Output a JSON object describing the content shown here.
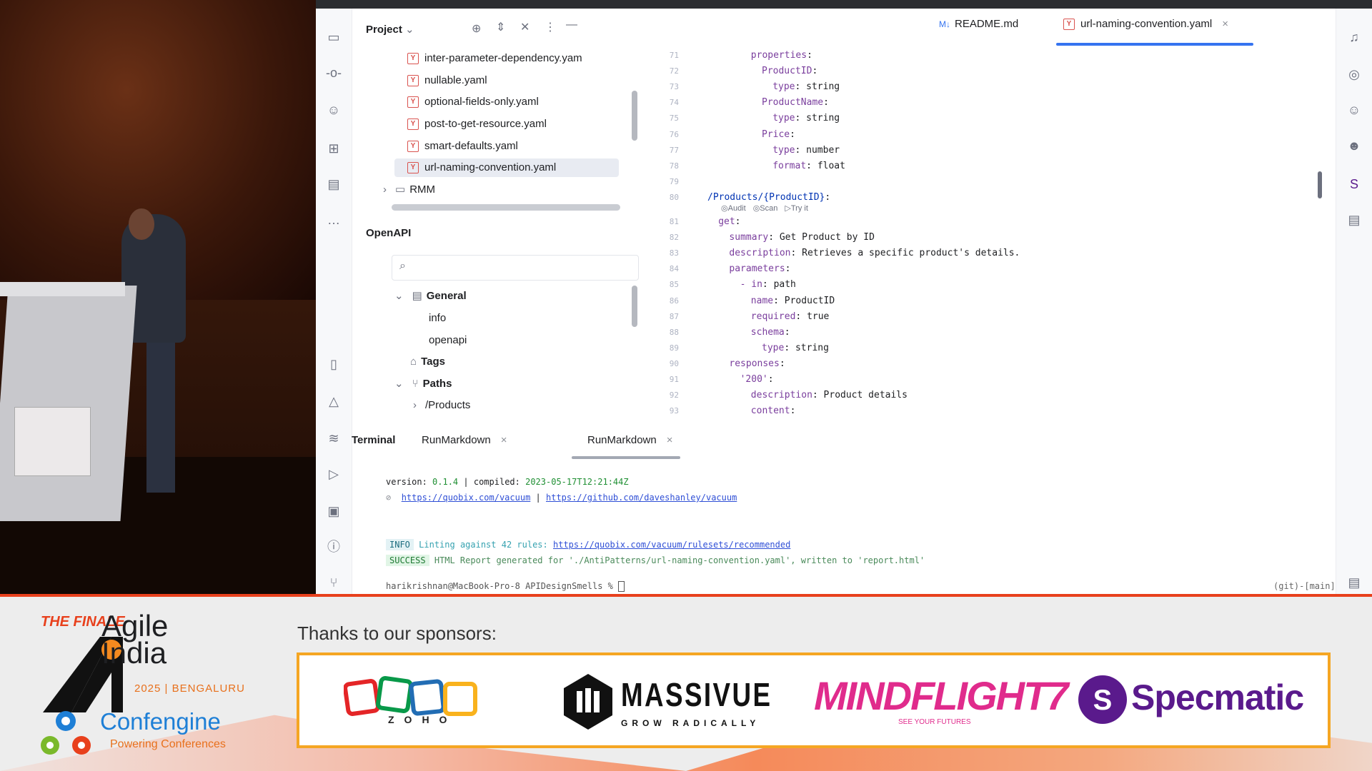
{
  "ide": {
    "project_title": "Project",
    "files": [
      "inter-parameter-dependency.yam",
      "nullable.yaml",
      "optional-fields-only.yaml",
      "post-to-get-resource.yaml",
      "smart-defaults.yaml",
      "url-naming-convention.yaml"
    ],
    "folder": "RMM",
    "openapi_title": "OpenAPI",
    "openapi_tree": {
      "general": "General",
      "info": "info",
      "openapi": "openapi",
      "tags": "Tags",
      "paths": "Paths",
      "products": "/Products"
    },
    "tabs": [
      {
        "icon": "M↓",
        "label": "README.md"
      },
      {
        "icon": "Y",
        "label": "url-naming-convention.yaml"
      }
    ],
    "code_lens": [
      "Audit",
      "Scan",
      "Try it"
    ],
    "lines": [
      {
        "n": "71",
        "indent": 8,
        "key": "properties",
        "val": ""
      },
      {
        "n": "72",
        "indent": 10,
        "key": "ProductID",
        "val": ""
      },
      {
        "n": "73",
        "indent": 12,
        "key": "type",
        "val": "string"
      },
      {
        "n": "74",
        "indent": 10,
        "key": "ProductName",
        "val": ""
      },
      {
        "n": "75",
        "indent": 12,
        "key": "type",
        "val": "string"
      },
      {
        "n": "76",
        "indent": 10,
        "key": "Price",
        "val": ""
      },
      {
        "n": "77",
        "indent": 12,
        "key": "type",
        "val": "number"
      },
      {
        "n": "78",
        "indent": 12,
        "key": "format",
        "val": "float"
      },
      {
        "n": "79",
        "indent": 0,
        "key": "",
        "val": ""
      },
      {
        "n": "80",
        "indent": 0,
        "key": "/Products/{ProductID}",
        "val": ""
      },
      {
        "n": "81",
        "indent": 2,
        "key": "get",
        "val": ""
      },
      {
        "n": "82",
        "indent": 4,
        "key": "summary",
        "val": "Get Product by ID"
      },
      {
        "n": "83",
        "indent": 4,
        "key": "description",
        "val": "Retrieves a specific product's details."
      },
      {
        "n": "84",
        "indent": 4,
        "key": "parameters",
        "val": ""
      },
      {
        "n": "85",
        "indent": 6,
        "key": "- in",
        "val": "path"
      },
      {
        "n": "86",
        "indent": 8,
        "key": "name",
        "val": "ProductID"
      },
      {
        "n": "87",
        "indent": 8,
        "key": "required",
        "val": "true"
      },
      {
        "n": "88",
        "indent": 8,
        "key": "schema",
        "val": ""
      },
      {
        "n": "89",
        "indent": 10,
        "key": "type",
        "val": "string"
      },
      {
        "n": "90",
        "indent": 4,
        "key": "responses",
        "val": ""
      },
      {
        "n": "91",
        "indent": 6,
        "key": "'200'",
        "val": ""
      },
      {
        "n": "92",
        "indent": 8,
        "key": "description",
        "val": "Product details"
      },
      {
        "n": "93",
        "indent": 8,
        "key": "content",
        "val": ""
      }
    ],
    "terminal_tabs": [
      "Terminal",
      "RunMarkdown",
      "RunMarkdown"
    ],
    "terminal": {
      "version_label": "version:",
      "version": "0.1.4",
      "compiled_label": "| compiled:",
      "compiled": "2023-05-17T12:21:44Z",
      "link1": "https://quobix.com/vacuum",
      "link2": "https://github.com/daveshanley/vacuum",
      "info_badge": "INFO",
      "info_text": "Linting against 42 rules:",
      "info_link": "https://quobix.com/vacuum/rulesets/recommended",
      "success_badge": "SUCCESS",
      "success_text": "HTML Report generated for './AntiPatterns/url-naming-convention.yaml', written to 'report.html'",
      "prompt": "harikrishnan@MacBook-Pro-8 APIDesignSmells % ",
      "git": "(git)-[main]"
    }
  },
  "banner": {
    "finale": "THE FINALE",
    "agile_line1": "Agile",
    "agile_line2": "India",
    "year": "2025 | BENGALURU",
    "confengine": "Confengine",
    "powering": "Powering Conferences",
    "thanks": "Thanks to our sponsors:",
    "sponsors": {
      "zoho": "ZOHO",
      "massive": "MASSIVUE",
      "massive_sub": "GROW RADICALLY",
      "mindflight": "MINDFLIGHT7",
      "mindflight_sub": "SEE YOUR FUTURES",
      "specmatic": "Specmatic"
    }
  },
  "colors": {
    "accent": "#3574f0",
    "brand_orange": "#e8401c",
    "sponsor_border": "#f5a623"
  }
}
